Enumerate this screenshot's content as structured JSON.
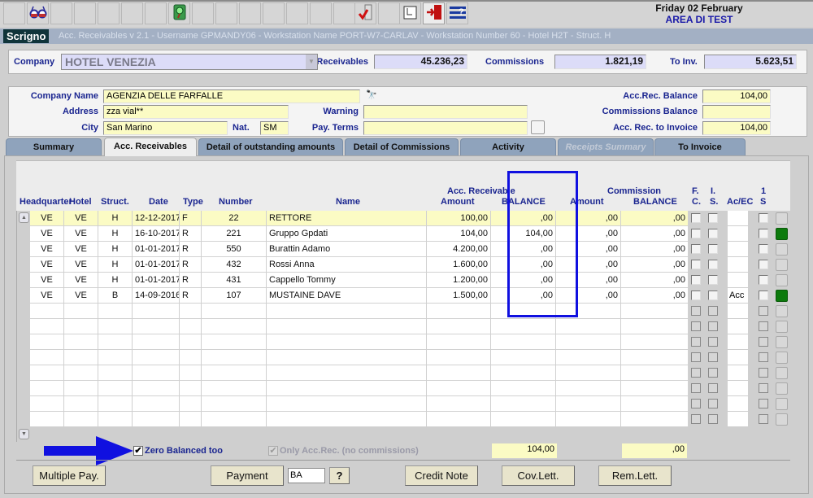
{
  "toolbar": {
    "icons": [
      "glasses-icon",
      "green-book-search-icon",
      "checklist-icon",
      "document-edit-icon",
      "exit-door-icon",
      "help-menu-icon"
    ],
    "date": "Friday 02 February",
    "area": "AREA DI TEST"
  },
  "titlebar": {
    "logo": "Scrigno",
    "text": "Acc. Receivables v 2.1 - Username GPMANDY06  - Workstation Name PORT-W7-CARLAV  - Workstation Number 60  -  Hotel H2T  -  Struct. H"
  },
  "company": {
    "label": "Company",
    "value": "HOTEL VENEZIA",
    "receivables_label": "Receivables",
    "receivables_value": "45.236,23",
    "commissions_label": "Commissions",
    "commissions_value": "1.821,19",
    "toinv_label": "To Inv.",
    "toinv_value": "5.623,51"
  },
  "detail": {
    "company_name_label": "Company Name",
    "company_name": "AGENZIA DELLE FARFALLE",
    "address_label": "Address",
    "address": "zza vial**",
    "city_label": "City",
    "city": "San Marino",
    "nat_label": "Nat.",
    "nat": "SM",
    "warning_label": "Warning",
    "warning": "",
    "pay_terms_label": "Pay. Terms",
    "pay_terms": "",
    "accrec_balance_label": "Acc.Rec. Balance",
    "accrec_balance": "104,00",
    "commissions_balance_label": "Commissions Balance",
    "commissions_balance": "",
    "accrec_to_invoice_label": "Acc. Rec. to Invoice",
    "accrec_to_invoice": "104,00"
  },
  "tabs": [
    {
      "label": "Summary",
      "state": "normal"
    },
    {
      "label": "Acc. Receivables",
      "state": "active"
    },
    {
      "label": "Detail of outstanding amounts",
      "state": "normal"
    },
    {
      "label": "Detail of Commissions",
      "state": "normal"
    },
    {
      "label": "Activity",
      "state": "normal"
    },
    {
      "label": "Receipts Summary",
      "state": "disabled"
    },
    {
      "label": "To Invoice",
      "state": "normal"
    }
  ],
  "grid": {
    "headers": {
      "headquarter": "Headquarter",
      "hotel": "Hotel",
      "struct": "Struct.",
      "date": "Date",
      "type": "Type",
      "number": "Number",
      "name": "Name",
      "acc_receivable_group": "Acc. Receivable",
      "amount": "Amount",
      "balance": "BALANCE",
      "commission_group": "Commission",
      "comm_amount": "Amount",
      "comm_balance": "BALANCE",
      "fc_top": "F.",
      "fc_bottom": "C.",
      "is_top": "I.",
      "is_bottom": "S.",
      "acec": "Ac/EC",
      "s1_top": "1",
      "s1_bottom": "S"
    },
    "rows": [
      {
        "hq": "VE",
        "hotel": "VE",
        "struct": "H",
        "date": "12-12-2017",
        "type": "F",
        "number": "22",
        "name": "RETTORE",
        "amount": "100,00",
        "balance": ",00",
        "comm_amount": ",00",
        "comm_balance": ",00",
        "acec": "",
        "flag": false,
        "selected": true
      },
      {
        "hq": "VE",
        "hotel": "VE",
        "struct": "H",
        "date": "16-10-2017",
        "type": "R",
        "number": "221",
        "name": "Gruppo Gpdati",
        "amount": "104,00",
        "balance": "104,00",
        "comm_amount": ",00",
        "comm_balance": ",00",
        "acec": "",
        "flag": true,
        "selected": false
      },
      {
        "hq": "VE",
        "hotel": "VE",
        "struct": "H",
        "date": "01-01-2017",
        "type": "R",
        "number": "550",
        "name": "Burattin Adamo",
        "amount": "4.200,00",
        "balance": ",00",
        "comm_amount": ",00",
        "comm_balance": ",00",
        "acec": "",
        "flag": false,
        "selected": false
      },
      {
        "hq": "VE",
        "hotel": "VE",
        "struct": "H",
        "date": "01-01-2017",
        "type": "R",
        "number": "432",
        "name": "Rossi Anna",
        "amount": "1.600,00",
        "balance": ",00",
        "comm_amount": ",00",
        "comm_balance": ",00",
        "acec": "",
        "flag": false,
        "selected": false
      },
      {
        "hq": "VE",
        "hotel": "VE",
        "struct": "H",
        "date": "01-01-2017",
        "type": "R",
        "number": "431",
        "name": "Cappello Tommy",
        "amount": "1.200,00",
        "balance": ",00",
        "comm_amount": ",00",
        "comm_balance": ",00",
        "acec": "",
        "flag": false,
        "selected": false
      },
      {
        "hq": "VE",
        "hotel": "VE",
        "struct": "B",
        "date": "14-09-2016",
        "type": "R",
        "number": "107",
        "name": "MUSTAINE DAVE",
        "amount": "1.500,00",
        "balance": ",00",
        "comm_amount": ",00",
        "comm_balance": ",00",
        "acec": "Acc",
        "flag": true,
        "selected": false
      }
    ],
    "empty_rows": 8
  },
  "footer": {
    "zero_balanced_label": "Zero Balanced too",
    "zero_balanced_checked": true,
    "only_accrec_label": "Only Acc.Rec. (no commissions)",
    "only_accrec_checked": true,
    "balance_total": "104,00",
    "commission_total": ",00",
    "payment_code": "BA",
    "buttons": {
      "multiple_pay": "Multiple Pay.",
      "payment": "Payment",
      "help": "?",
      "credit_note": "Credit Note",
      "cov_lett": "Cov.Lett.",
      "rem_lett": "Rem.Lett."
    }
  },
  "annotations": {
    "arrow_color": "#1010e0",
    "highlight_color": "#1010e0"
  }
}
